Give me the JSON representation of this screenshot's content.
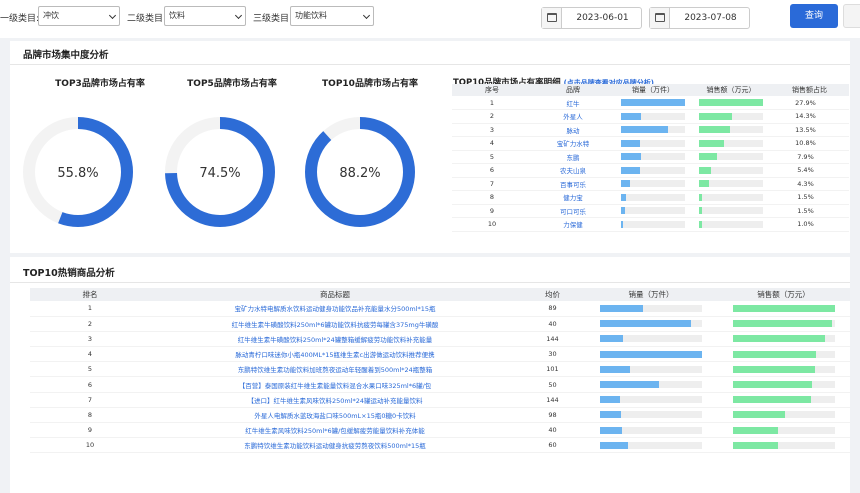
{
  "filters": {
    "level1_label": "一级类目:",
    "level1_value": "冲饮",
    "level2_label": "二级类目:",
    "level2_value": "饮料",
    "level3_label": "三级类目:",
    "level3_value": "功能饮料",
    "start_date": "2023-06-01",
    "end_date": "2023-07-08",
    "query_label": "查询"
  },
  "concentration": {
    "title": "品牌市场集中度分析",
    "donuts": [
      {
        "label": "TOP3品牌市场占有率",
        "value": 55.8,
        "text": "55.8%"
      },
      {
        "label": "TOP5品牌市场占有率",
        "value": 74.5,
        "text": "74.5%"
      },
      {
        "label": "TOP10品牌市场占有率",
        "value": 88.2,
        "text": "88.2%"
      }
    ],
    "detail_title": "TOP10品牌市场占有率明细",
    "detail_hint": "(点击品牌查看对应品牌分析)",
    "headers": [
      "序号",
      "品牌",
      "销量（万件）",
      "销售额（万元）",
      "销售额占比"
    ],
    "rows": [
      {
        "rank": "1",
        "brand": "红牛",
        "sales": 100,
        "revenue": 100,
        "share": "27.9%"
      },
      {
        "rank": "2",
        "brand": "外星人",
        "sales": 32,
        "revenue": 51,
        "share": "14.3%"
      },
      {
        "rank": "3",
        "brand": "脉动",
        "sales": 74,
        "revenue": 49,
        "share": "13.5%"
      },
      {
        "rank": "4",
        "brand": "宝矿力水特",
        "sales": 29,
        "revenue": 39,
        "share": "10.8%"
      },
      {
        "rank": "5",
        "brand": "东鹏",
        "sales": 32,
        "revenue": 28,
        "share": "7.9%"
      },
      {
        "rank": "6",
        "brand": "农夫山泉",
        "sales": 29,
        "revenue": 19,
        "share": "5.4%"
      },
      {
        "rank": "7",
        "brand": "百事可乐",
        "sales": 14,
        "revenue": 15,
        "share": "4.3%"
      },
      {
        "rank": "8",
        "brand": "健力宝",
        "sales": 8,
        "revenue": 5,
        "share": "1.5%"
      },
      {
        "rank": "9",
        "brand": "可口可乐",
        "sales": 6,
        "revenue": 5,
        "share": "1.5%"
      },
      {
        "rank": "10",
        "brand": "力保健",
        "sales": 3,
        "revenue": 4,
        "share": "1.0%"
      }
    ]
  },
  "hot": {
    "title": "TOP10热销商品分析",
    "headers": [
      "排名",
      "商品标题",
      "均价",
      "销量（万件）",
      "销售额（万元）"
    ],
    "rows": [
      {
        "rank": "1",
        "title": "宝矿力水特电解质水饮料运动健身功能饮品补充能量水分500ml*15瓶",
        "price": "89",
        "sales": 42,
        "revenue": 100
      },
      {
        "rank": "2",
        "title": "红牛维生素牛磺酸饮料250ml*6罐功能饮料抗疲劳每罐含375mg牛磺酸",
        "price": "40",
        "sales": 89,
        "revenue": 98
      },
      {
        "rank": "3",
        "title": "红牛维生素牛磺酸饮料250ml*24罐整箱缓解疲劳功能饮料补充能量",
        "price": "144",
        "sales": 23,
        "revenue": 91
      },
      {
        "rank": "4",
        "title": "脉动青柠口味迷你小瓶400ML*15瓶维生素c出游做运动饮料推荐便携",
        "price": "30",
        "sales": 100,
        "revenue": 82
      },
      {
        "rank": "5",
        "title": "东鹏特饮维生素功能饮料加班熬夜运动年轻醒着到500ml*24瓶整箱",
        "price": "101",
        "sales": 29,
        "revenue": 81
      },
      {
        "rank": "6",
        "title": "【百营】泰国原装红牛维生素能量饮料混合水果口味325ml*6罐/包",
        "price": "50",
        "sales": 58,
        "revenue": 78
      },
      {
        "rank": "7",
        "title": "【进口】红牛维生素风味饮料250ml*24罐运动补充能量饮料",
        "price": "144",
        "sales": 20,
        "revenue": 77
      },
      {
        "rank": "8",
        "title": "外星人电解质水蓝玫海盐口味500mL×15瓶0糖0卡饮料",
        "price": "98",
        "sales": 21,
        "revenue": 51
      },
      {
        "rank": "9",
        "title": "红牛维生素风味饮料250ml*6罐/包缓解疲劳能量饮料补充体能",
        "price": "40",
        "sales": 22,
        "revenue": 45
      },
      {
        "rank": "10",
        "title": "东鹏特饮维生素功能饮料运动健身抗疲劳熬夜饮料500ml*15瓶",
        "price": "60",
        "sales": 27,
        "revenue": 45
      }
    ]
  },
  "colors": {
    "accent": "#2a6ad8",
    "donut": "#2d6cd6",
    "sales_bar": "#6cb4f0",
    "revenue_bar": "#7de8a3"
  }
}
